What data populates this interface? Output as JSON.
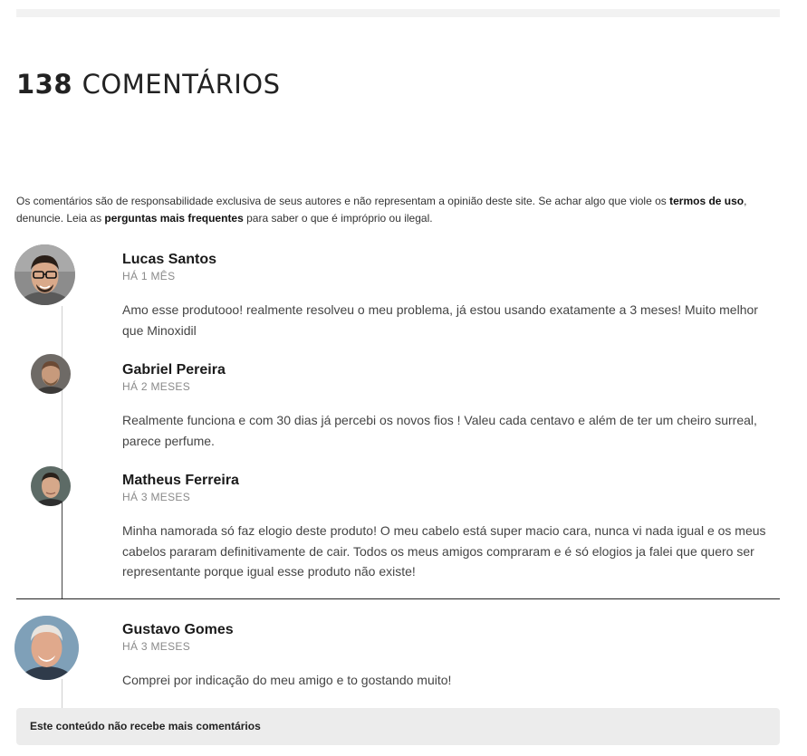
{
  "header": {
    "count": "138",
    "title_word": "COMENTÁRIOS"
  },
  "disclaimer": {
    "part1": "Os comentários são de responsabilidade exclusiva de seus autores e não representam a opinião deste site. Se achar algo que viole os ",
    "terms_link": "termos de uso",
    "part2": ", denuncie. Leia as ",
    "faq_link": "perguntas mais frequentes",
    "part3": " para saber o que é impróprio ou ilegal."
  },
  "comments": [
    {
      "author": "Lucas Santos",
      "time": "HÁ 1 MÊS",
      "text": "Amo esse produtooo! realmente resolveu o meu problema, já estou usando exatamente a 3 meses! Muito melhor que Minoxidil",
      "avatar_icon": "avatar-lucas-icon"
    },
    {
      "author": "Gabriel Pereira",
      "time": "HÁ 2 MESES",
      "text": "Realmente funciona e com 30 dias já percebi os novos fios ! Valeu cada centavo e além de ter um cheiro surreal, parece perfume.",
      "avatar_icon": "avatar-gabriel-icon"
    },
    {
      "author": "Matheus Ferreira",
      "time": "HÁ 3 MESES",
      "text": "Minha namorada só faz elogio deste produto! O meu cabelo está super macio cara, nunca vi nada igual e os meus cabelos pararam definitivamente de cair. Todos os meus amigos compraram e é só elogios ja falei  que quero ser representante porque igual esse produto não existe!",
      "avatar_icon": "avatar-matheus-icon"
    },
    {
      "author": "Gustavo Gomes",
      "time": "HÁ 3 MESES",
      "text": "Comprei por indicação do meu amigo e to gostando muito!",
      "avatar_icon": "avatar-gustavo-icon"
    }
  ],
  "footer": {
    "closed_notice": "Este conteúdo não recebe mais comentários"
  }
}
